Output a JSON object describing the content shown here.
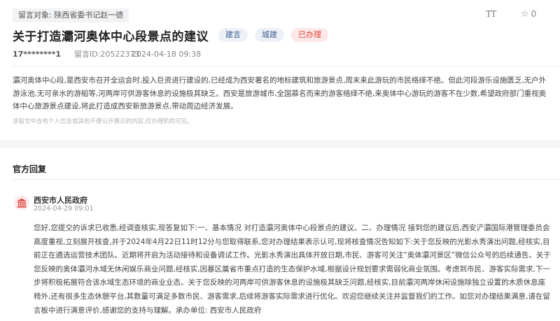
{
  "header": {
    "target_label": "留言对象:",
    "target_name": "陕西省委书记赵一德",
    "font_button": "TT",
    "favorite_count": "0"
  },
  "message": {
    "title": "关于打造灞河奥体中心段景点的建议",
    "tags": [
      "建言",
      "城建"
    ],
    "status": "已办理",
    "user": "17********1",
    "id_label": "留言ID:20522373",
    "datetime": "2024-04-18 09:38",
    "content": "灞河奥体中心段,是西安市召开全运会时,投入巨资进行建设的,已经成为西安著名的地标建筑和旅游景点,周末来此游玩的市民络绎不绝。但此河段游乐设施匮乏,无户外游泳池,无可亲水的游船等,河两岸可供游客休息的设施极其缺乏。西安是旅游城市,全国慕名而来的游客络绎不绝,来奥体中心游玩的游客不在少数,希望政府部门重视奥体中心旅游景点建设,将此打造成西安新旅游景点,带动周边经济发展。",
    "privacy_notice": "该留言中含有个人信息或其他不便公开展示的内容,仅办理机构可见。"
  },
  "reply": {
    "section_title": "官方回复",
    "org_name": "西安市人民政府",
    "datetime": "2024-04-29 09:01",
    "text": "您好,您提交的诉求已收悉,经调查核实,现答复如下:一、基本情况 对打造灞河奥体中心段景点的建议。二、办理情况 接到您的建议后,西安浐灞国际港管理委员会高度重视,立刻展开核查,并于2024年4月22日11时12分与您取得联系,您对办理结果表示认可,现将核查情况告知如下:关于您反映的光影水秀演出问题,经核实,目前正在遴选运营技术团队。近期将开启为活动接待和设备调试工作。光影水秀演出具体开放日期,市民、游客可关注“奥体灞河景区”微信公众号的后续通告。关于您反映的奥体灞河水域无休闲娱乐商业问题,经核实,因暴区属省市重点打造的生态保护水域,根据设计规划要求需弱化商业氛围。考虑到市民、游客实际需求,下一步将积极拓展符合该水域生态环境的商业业态。关于您反映的河两岸可供游客休息的设施极其缺乏问题,经核实,目前灞河两岸休闲设施除独立设置的木质休息座椅外,还有很多生态休憩平台,其数量可满足多数市民、游客需求,后续将游客实际需求进行优化。欢迎您继续关注并监督我们的工作。如您对办理结果满意,请在留言板中进行满意评价,感谢您的支持与理解。承办单位: 西安市人民政府"
  },
  "colors": {
    "status_red": "#e2433b",
    "tag_blue": "#3a5f8f",
    "icon_red": "#d9403a"
  }
}
